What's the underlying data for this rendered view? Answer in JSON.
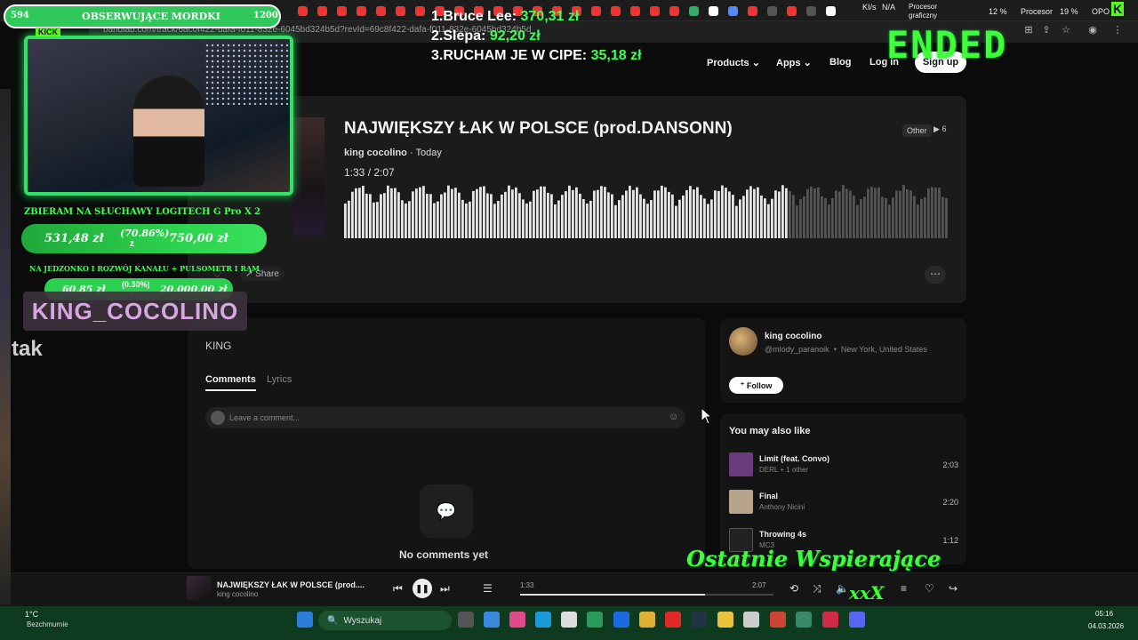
{
  "browser": {
    "url": "bandlab.com/track/6ac0f422-dafa-f011-832e-6045bd324b5d?revId=69c8f422-dafa-f011-832e-6045bd324b5d",
    "meters": {
      "net_label": "KI/s",
      "net_value": "N/A",
      "gpu_label": "Procesor graficzny",
      "cpu_pct": "12 %",
      "cpu_label": "Procesor",
      "cpu2_pct": "19 %",
      "mem_label": "OPO"
    }
  },
  "site_nav": {
    "products": "Products",
    "apps": "Apps",
    "blog": "Blog",
    "login": "Log in",
    "signup": "Sign up"
  },
  "track": {
    "title": "NAJWIĘKSZY ŁAK W POLSCE (prod.DANSONN)",
    "artist": "king cocolino",
    "date": "Today",
    "current_time": "1:33",
    "total_time": "2:07",
    "genre": "Other",
    "plays": "6",
    "share": "Share",
    "progress_fraction": 0.73
  },
  "description": {
    "text": "KING",
    "tab_comments": "Comments",
    "tab_lyrics": "Lyrics",
    "comment_placeholder": "Leave a comment...",
    "no_comments": "No comments yet"
  },
  "artist_card": {
    "name": "king cocolino",
    "handle": "@mlody_paranoik",
    "location": "New York, United States",
    "follow": "Follow"
  },
  "suggestions": {
    "title": "You may also like",
    "items": [
      {
        "title": "Limit (feat. Convo)",
        "artist": "DERL + 1 other",
        "duration": "2:03",
        "color": "#6a3a7a"
      },
      {
        "title": "Final",
        "artist": "Anthony Nicini",
        "duration": "2:20",
        "color": "#b8a48a"
      },
      {
        "title": "Throwing 4s",
        "artist": "MC3",
        "duration": "1:12",
        "color": "#222222"
      }
    ]
  },
  "player": {
    "title": "NAJWIĘKSZY ŁAK W POLSCE (prod....",
    "artist": "king cocolino",
    "current_time": "1:33",
    "total_time": "2:07",
    "progress_fraction": 0.73
  },
  "taskbar": {
    "temp": "1°C",
    "weather": "Bezchmurnie",
    "search": "Wyszukaj",
    "time": "05:16",
    "date": "04.03.2026"
  },
  "overlay": {
    "follower_count": "594",
    "follower_label": "OBSERWUJĄCE MORDKI",
    "follower_goal": "1200",
    "kick": "KICK",
    "donors": [
      {
        "rank": "1.",
        "name": "Bruce Lee:",
        "amount": "370,31 zł"
      },
      {
        "rank": "2.",
        "name": "Slepa:",
        "amount": "92,20 zł"
      },
      {
        "rank": "3.",
        "name": "RUCHAM JE W CIPE:",
        "amount": "35,18 zł"
      }
    ],
    "ended": "ENDED",
    "goal1_title": "ZBIERAM NA SŁUCHAWY LOGITECH G Pro X 2",
    "goal1_current": "531,48 zł",
    "goal1_pct": "(70.86%)",
    "goal1_z": "z",
    "goal1_target": "750,00 zł",
    "goal2_title": "NA JEDZONKO I ROZWÓJ KANAŁU + PULSOMETR I RAM",
    "goal2_current": "60,85 zł",
    "goal2_pct": "(0.30%)",
    "goal2_z": "z",
    "goal2_target": "20.000,00 zł",
    "streamer": "KING_COCOLINO",
    "chat_msg": "tak",
    "last_support": "Ostatnie Wspierające",
    "last_support_sub": "xxX"
  },
  "colors": {
    "accent_green": "#3dff36",
    "kick_green": "#53fc18"
  }
}
